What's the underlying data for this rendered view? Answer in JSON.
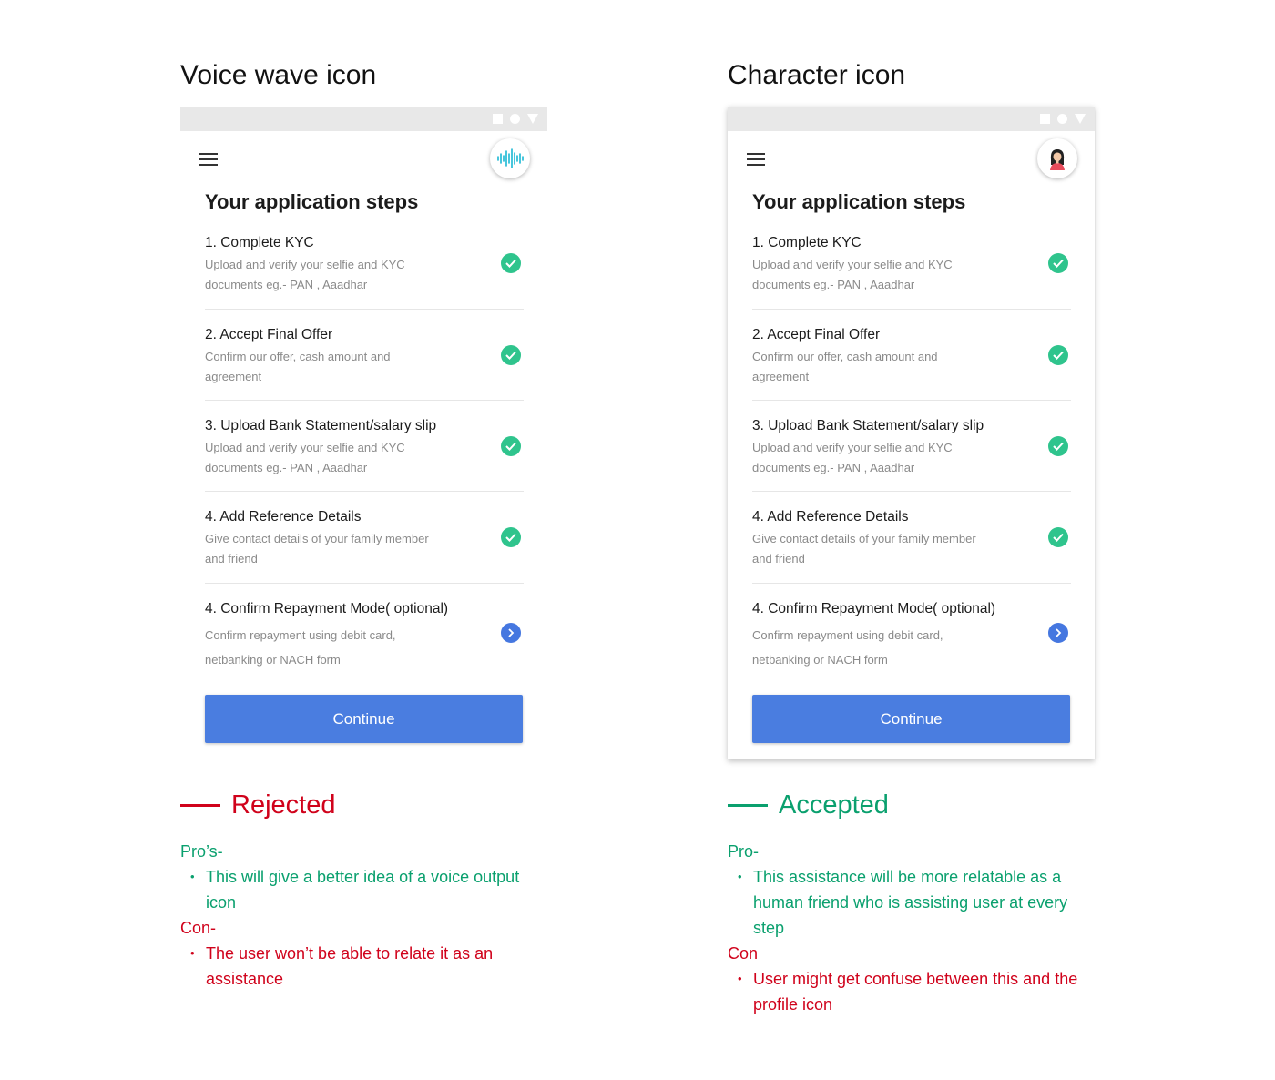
{
  "columns": [
    {
      "title": "Voice wave icon",
      "assistant_icon": "voice-wave-icon",
      "verdict": "Rejected",
      "pro_label": "Pro’s-",
      "pros": [
        "This will give a better idea of a voice output icon"
      ],
      "con_label": "Con-",
      "cons": [
        "The user won’t be able to relate it as an assistance"
      ]
    },
    {
      "title": "Character icon",
      "assistant_icon": "character-avatar-icon",
      "verdict": "Accepted",
      "pro_label": "Pro-",
      "pros": [
        "This assistance will be more relatable as a human friend who is assisting user at every step"
      ],
      "con_label": "Con",
      "cons": [
        "User might get confuse between this and the profile icon"
      ]
    }
  ],
  "app": {
    "heading": "Your application steps",
    "steps": [
      {
        "title": "1. Complete KYC",
        "desc": "Upload and verify your selfie and KYC documents eg.- PAN , Aaadhar",
        "status": "done"
      },
      {
        "title": "2. Accept Final Offer",
        "desc": "Confirm our offer, cash amount and agreement",
        "status": "done"
      },
      {
        "title": "3. Upload Bank Statement/salary slip",
        "desc": "Upload and verify your selfie and KYC documents eg.- PAN , Aaadhar",
        "status": "done"
      },
      {
        "title": "4. Add Reference Details",
        "desc": "Give contact details of your family member and friend",
        "status": "done"
      },
      {
        "title": "4. Confirm Repayment Mode( optional)",
        "desc": "Confirm repayment using debit card, netbanking or NACH form",
        "status": "pending"
      }
    ],
    "continue_label": "Continue"
  },
  "colors": {
    "primary_blue": "#4a7de0",
    "check_green": "#2fc48d",
    "rejected_red": "#d0021b",
    "accepted_green": "#0aa06e",
    "wave_teal": "#1ab7d4"
  }
}
